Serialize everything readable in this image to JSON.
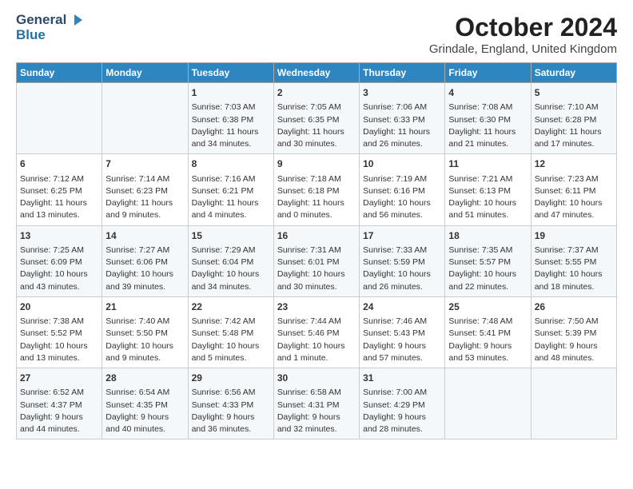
{
  "logo": {
    "general": "General",
    "blue": "Blue",
    "triangle": "▶"
  },
  "title": "October 2024",
  "subtitle": "Grindale, England, United Kingdom",
  "days_of_week": [
    "Sunday",
    "Monday",
    "Tuesday",
    "Wednesday",
    "Thursday",
    "Friday",
    "Saturday"
  ],
  "weeks": [
    [
      {
        "day": "",
        "content": ""
      },
      {
        "day": "",
        "content": ""
      },
      {
        "day": "1",
        "content": "Sunrise: 7:03 AM\nSunset: 6:38 PM\nDaylight: 11 hours\nand 34 minutes."
      },
      {
        "day": "2",
        "content": "Sunrise: 7:05 AM\nSunset: 6:35 PM\nDaylight: 11 hours\nand 30 minutes."
      },
      {
        "day": "3",
        "content": "Sunrise: 7:06 AM\nSunset: 6:33 PM\nDaylight: 11 hours\nand 26 minutes."
      },
      {
        "day": "4",
        "content": "Sunrise: 7:08 AM\nSunset: 6:30 PM\nDaylight: 11 hours\nand 21 minutes."
      },
      {
        "day": "5",
        "content": "Sunrise: 7:10 AM\nSunset: 6:28 PM\nDaylight: 11 hours\nand 17 minutes."
      }
    ],
    [
      {
        "day": "6",
        "content": "Sunrise: 7:12 AM\nSunset: 6:25 PM\nDaylight: 11 hours\nand 13 minutes."
      },
      {
        "day": "7",
        "content": "Sunrise: 7:14 AM\nSunset: 6:23 PM\nDaylight: 11 hours\nand 9 minutes."
      },
      {
        "day": "8",
        "content": "Sunrise: 7:16 AM\nSunset: 6:21 PM\nDaylight: 11 hours\nand 4 minutes."
      },
      {
        "day": "9",
        "content": "Sunrise: 7:18 AM\nSunset: 6:18 PM\nDaylight: 11 hours\nand 0 minutes."
      },
      {
        "day": "10",
        "content": "Sunrise: 7:19 AM\nSunset: 6:16 PM\nDaylight: 10 hours\nand 56 minutes."
      },
      {
        "day": "11",
        "content": "Sunrise: 7:21 AM\nSunset: 6:13 PM\nDaylight: 10 hours\nand 51 minutes."
      },
      {
        "day": "12",
        "content": "Sunrise: 7:23 AM\nSunset: 6:11 PM\nDaylight: 10 hours\nand 47 minutes."
      }
    ],
    [
      {
        "day": "13",
        "content": "Sunrise: 7:25 AM\nSunset: 6:09 PM\nDaylight: 10 hours\nand 43 minutes."
      },
      {
        "day": "14",
        "content": "Sunrise: 7:27 AM\nSunset: 6:06 PM\nDaylight: 10 hours\nand 39 minutes."
      },
      {
        "day": "15",
        "content": "Sunrise: 7:29 AM\nSunset: 6:04 PM\nDaylight: 10 hours\nand 34 minutes."
      },
      {
        "day": "16",
        "content": "Sunrise: 7:31 AM\nSunset: 6:01 PM\nDaylight: 10 hours\nand 30 minutes."
      },
      {
        "day": "17",
        "content": "Sunrise: 7:33 AM\nSunset: 5:59 PM\nDaylight: 10 hours\nand 26 minutes."
      },
      {
        "day": "18",
        "content": "Sunrise: 7:35 AM\nSunset: 5:57 PM\nDaylight: 10 hours\nand 22 minutes."
      },
      {
        "day": "19",
        "content": "Sunrise: 7:37 AM\nSunset: 5:55 PM\nDaylight: 10 hours\nand 18 minutes."
      }
    ],
    [
      {
        "day": "20",
        "content": "Sunrise: 7:38 AM\nSunset: 5:52 PM\nDaylight: 10 hours\nand 13 minutes."
      },
      {
        "day": "21",
        "content": "Sunrise: 7:40 AM\nSunset: 5:50 PM\nDaylight: 10 hours\nand 9 minutes."
      },
      {
        "day": "22",
        "content": "Sunrise: 7:42 AM\nSunset: 5:48 PM\nDaylight: 10 hours\nand 5 minutes."
      },
      {
        "day": "23",
        "content": "Sunrise: 7:44 AM\nSunset: 5:46 PM\nDaylight: 10 hours\nand 1 minute."
      },
      {
        "day": "24",
        "content": "Sunrise: 7:46 AM\nSunset: 5:43 PM\nDaylight: 9 hours\nand 57 minutes."
      },
      {
        "day": "25",
        "content": "Sunrise: 7:48 AM\nSunset: 5:41 PM\nDaylight: 9 hours\nand 53 minutes."
      },
      {
        "day": "26",
        "content": "Sunrise: 7:50 AM\nSunset: 5:39 PM\nDaylight: 9 hours\nand 48 minutes."
      }
    ],
    [
      {
        "day": "27",
        "content": "Sunrise: 6:52 AM\nSunset: 4:37 PM\nDaylight: 9 hours\nand 44 minutes."
      },
      {
        "day": "28",
        "content": "Sunrise: 6:54 AM\nSunset: 4:35 PM\nDaylight: 9 hours\nand 40 minutes."
      },
      {
        "day": "29",
        "content": "Sunrise: 6:56 AM\nSunset: 4:33 PM\nDaylight: 9 hours\nand 36 minutes."
      },
      {
        "day": "30",
        "content": "Sunrise: 6:58 AM\nSunset: 4:31 PM\nDaylight: 9 hours\nand 32 minutes."
      },
      {
        "day": "31",
        "content": "Sunrise: 7:00 AM\nSunset: 4:29 PM\nDaylight: 9 hours\nand 28 minutes."
      },
      {
        "day": "",
        "content": ""
      },
      {
        "day": "",
        "content": ""
      }
    ]
  ]
}
